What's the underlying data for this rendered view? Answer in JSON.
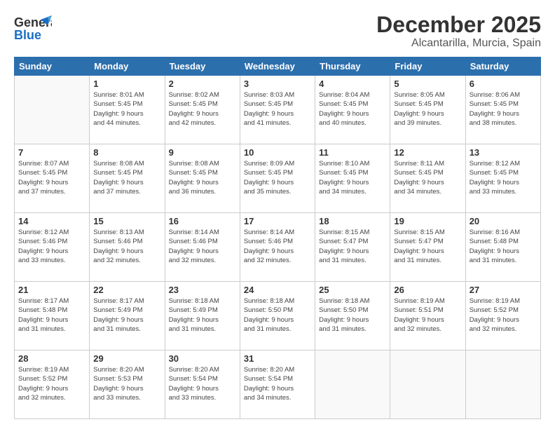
{
  "header": {
    "logo_line1": "General",
    "logo_line2": "Blue",
    "month": "December 2025",
    "location": "Alcantarilla, Murcia, Spain"
  },
  "days_of_week": [
    "Sunday",
    "Monday",
    "Tuesday",
    "Wednesday",
    "Thursday",
    "Friday",
    "Saturday"
  ],
  "weeks": [
    [
      {
        "day": "",
        "info": ""
      },
      {
        "day": "1",
        "info": "Sunrise: 8:01 AM\nSunset: 5:45 PM\nDaylight: 9 hours\nand 44 minutes."
      },
      {
        "day": "2",
        "info": "Sunrise: 8:02 AM\nSunset: 5:45 PM\nDaylight: 9 hours\nand 42 minutes."
      },
      {
        "day": "3",
        "info": "Sunrise: 8:03 AM\nSunset: 5:45 PM\nDaylight: 9 hours\nand 41 minutes."
      },
      {
        "day": "4",
        "info": "Sunrise: 8:04 AM\nSunset: 5:45 PM\nDaylight: 9 hours\nand 40 minutes."
      },
      {
        "day": "5",
        "info": "Sunrise: 8:05 AM\nSunset: 5:45 PM\nDaylight: 9 hours\nand 39 minutes."
      },
      {
        "day": "6",
        "info": "Sunrise: 8:06 AM\nSunset: 5:45 PM\nDaylight: 9 hours\nand 38 minutes."
      }
    ],
    [
      {
        "day": "7",
        "info": "Sunrise: 8:07 AM\nSunset: 5:45 PM\nDaylight: 9 hours\nand 37 minutes."
      },
      {
        "day": "8",
        "info": "Sunrise: 8:08 AM\nSunset: 5:45 PM\nDaylight: 9 hours\nand 37 minutes."
      },
      {
        "day": "9",
        "info": "Sunrise: 8:08 AM\nSunset: 5:45 PM\nDaylight: 9 hours\nand 36 minutes."
      },
      {
        "day": "10",
        "info": "Sunrise: 8:09 AM\nSunset: 5:45 PM\nDaylight: 9 hours\nand 35 minutes."
      },
      {
        "day": "11",
        "info": "Sunrise: 8:10 AM\nSunset: 5:45 PM\nDaylight: 9 hours\nand 34 minutes."
      },
      {
        "day": "12",
        "info": "Sunrise: 8:11 AM\nSunset: 5:45 PM\nDaylight: 9 hours\nand 34 minutes."
      },
      {
        "day": "13",
        "info": "Sunrise: 8:12 AM\nSunset: 5:45 PM\nDaylight: 9 hours\nand 33 minutes."
      }
    ],
    [
      {
        "day": "14",
        "info": "Sunrise: 8:12 AM\nSunset: 5:46 PM\nDaylight: 9 hours\nand 33 minutes."
      },
      {
        "day": "15",
        "info": "Sunrise: 8:13 AM\nSunset: 5:46 PM\nDaylight: 9 hours\nand 32 minutes."
      },
      {
        "day": "16",
        "info": "Sunrise: 8:14 AM\nSunset: 5:46 PM\nDaylight: 9 hours\nand 32 minutes."
      },
      {
        "day": "17",
        "info": "Sunrise: 8:14 AM\nSunset: 5:46 PM\nDaylight: 9 hours\nand 32 minutes."
      },
      {
        "day": "18",
        "info": "Sunrise: 8:15 AM\nSunset: 5:47 PM\nDaylight: 9 hours\nand 31 minutes."
      },
      {
        "day": "19",
        "info": "Sunrise: 8:15 AM\nSunset: 5:47 PM\nDaylight: 9 hours\nand 31 minutes."
      },
      {
        "day": "20",
        "info": "Sunrise: 8:16 AM\nSunset: 5:48 PM\nDaylight: 9 hours\nand 31 minutes."
      }
    ],
    [
      {
        "day": "21",
        "info": "Sunrise: 8:17 AM\nSunset: 5:48 PM\nDaylight: 9 hours\nand 31 minutes."
      },
      {
        "day": "22",
        "info": "Sunrise: 8:17 AM\nSunset: 5:49 PM\nDaylight: 9 hours\nand 31 minutes."
      },
      {
        "day": "23",
        "info": "Sunrise: 8:18 AM\nSunset: 5:49 PM\nDaylight: 9 hours\nand 31 minutes."
      },
      {
        "day": "24",
        "info": "Sunrise: 8:18 AM\nSunset: 5:50 PM\nDaylight: 9 hours\nand 31 minutes."
      },
      {
        "day": "25",
        "info": "Sunrise: 8:18 AM\nSunset: 5:50 PM\nDaylight: 9 hours\nand 31 minutes."
      },
      {
        "day": "26",
        "info": "Sunrise: 8:19 AM\nSunset: 5:51 PM\nDaylight: 9 hours\nand 32 minutes."
      },
      {
        "day": "27",
        "info": "Sunrise: 8:19 AM\nSunset: 5:52 PM\nDaylight: 9 hours\nand 32 minutes."
      }
    ],
    [
      {
        "day": "28",
        "info": "Sunrise: 8:19 AM\nSunset: 5:52 PM\nDaylight: 9 hours\nand 32 minutes."
      },
      {
        "day": "29",
        "info": "Sunrise: 8:20 AM\nSunset: 5:53 PM\nDaylight: 9 hours\nand 33 minutes."
      },
      {
        "day": "30",
        "info": "Sunrise: 8:20 AM\nSunset: 5:54 PM\nDaylight: 9 hours\nand 33 minutes."
      },
      {
        "day": "31",
        "info": "Sunrise: 8:20 AM\nSunset: 5:54 PM\nDaylight: 9 hours\nand 34 minutes."
      },
      {
        "day": "",
        "info": ""
      },
      {
        "day": "",
        "info": ""
      },
      {
        "day": "",
        "info": ""
      }
    ]
  ]
}
